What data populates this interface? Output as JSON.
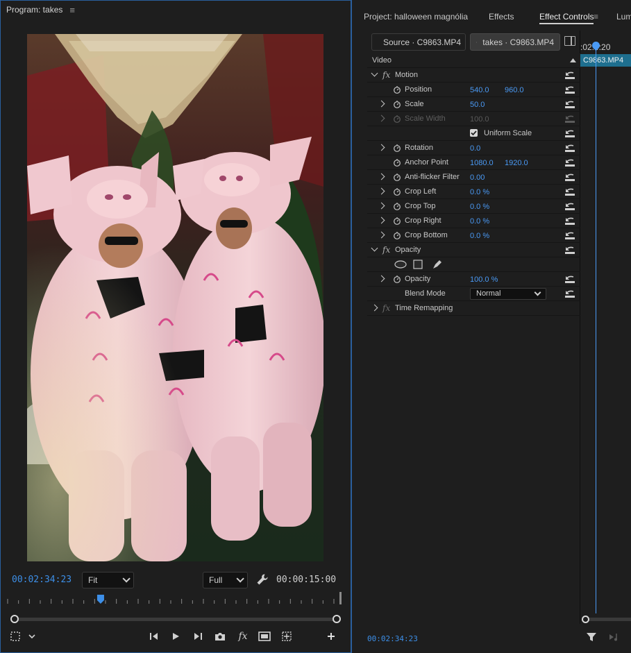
{
  "program_monitor": {
    "title": "Program: takes",
    "timecode": "00:02:34:23",
    "zoom": "Fit",
    "quality": "Full",
    "duration": "00:00:15:00",
    "playhead_fraction": 0.285,
    "scrub_in_fraction": 0.0,
    "scrub_out_fraction": 1.0
  },
  "tabs": [
    {
      "label": "Project: halloween magnólia",
      "active": false
    },
    {
      "label": "Effects",
      "active": false
    },
    {
      "label": "Effect Controls",
      "active": true
    },
    {
      "label": "Lum",
      "active": false
    }
  ],
  "effect_controls": {
    "source_label": "Source · C9863.MP4",
    "sequence_label": "takes · C9863.MP4",
    "section_video": "Video",
    "motion": {
      "label": "Motion",
      "position_label": "Position",
      "position_x": "540.0",
      "position_y": "960.0",
      "scale_label": "Scale",
      "scale": "50.0",
      "scale_width_label": "Scale Width",
      "scale_width": "100.0",
      "uniform_scale_label": "Uniform Scale",
      "uniform_scale_checked": true,
      "rotation_label": "Rotation",
      "rotation": "0.0",
      "anchor_label": "Anchor Point",
      "anchor_x": "1080.0",
      "anchor_y": "1920.0",
      "antiflicker_label": "Anti-flicker Filter",
      "antiflicker": "0.00",
      "crop_left_label": "Crop Left",
      "crop_left": "0.0 %",
      "crop_top_label": "Crop Top",
      "crop_top": "0.0 %",
      "crop_right_label": "Crop Right",
      "crop_right": "0.0 %",
      "crop_bottom_label": "Crop Bottom",
      "crop_bottom": "0.0 %"
    },
    "opacity": {
      "label": "Opacity",
      "opacity_label": "Opacity",
      "opacity": "100.0 %",
      "blend_label": "Blend Mode",
      "blend": "Normal"
    },
    "time_remapping_label": "Time Remapping",
    "timeline_tc": ":02:4:20",
    "clip_name": "C9863.MP4",
    "footer_timecode": "00:02:34:23"
  },
  "icons": {
    "panel_menu": "hamburger-icon",
    "settings": "wrench-icon",
    "filter": "filter-icon"
  },
  "colors": {
    "accent_blue": "#3d8fe8",
    "clip_teal": "#1e6f8f",
    "panel_bg": "#1e1e1e"
  }
}
